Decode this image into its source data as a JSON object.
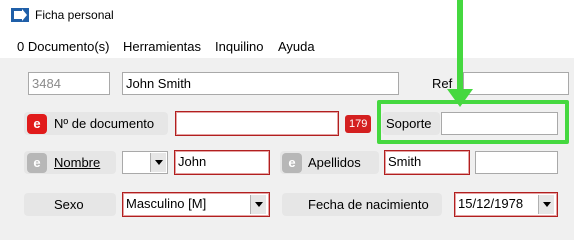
{
  "window": {
    "title": "Ficha personal",
    "icon": "app-arrow-icon"
  },
  "menu": [
    "0 Documento(s)",
    "Herramientas",
    "Inquilino",
    "Ayuda"
  ],
  "row1": {
    "id_value": "3484",
    "name_value": "John Smith",
    "ref_label": "Ref",
    "ref_value": ""
  },
  "row2": {
    "badge": "e",
    "doc_label": "Nº de documento",
    "doc_value": "",
    "count_badge": "179",
    "soporte_label": "Soporte",
    "soporte_value": ""
  },
  "row3": {
    "badge": "e",
    "nombre_label": "Nombre",
    "nombre_prefix": "",
    "nombre_value": "John",
    "apellidos_badge": "e",
    "apellidos_label": "Apellidos",
    "apellido1_value": "Smith",
    "apellido2_value": ""
  },
  "row4": {
    "sexo_label": "Sexo",
    "sexo_value": "Masculino [M]",
    "fecha_label": "Fecha de nacimiento",
    "fecha_value": "15/12/1978"
  },
  "colors": {
    "highlight": "#45d83f",
    "required_border": "#b11f1f",
    "badge_red": "#e11b1b"
  }
}
